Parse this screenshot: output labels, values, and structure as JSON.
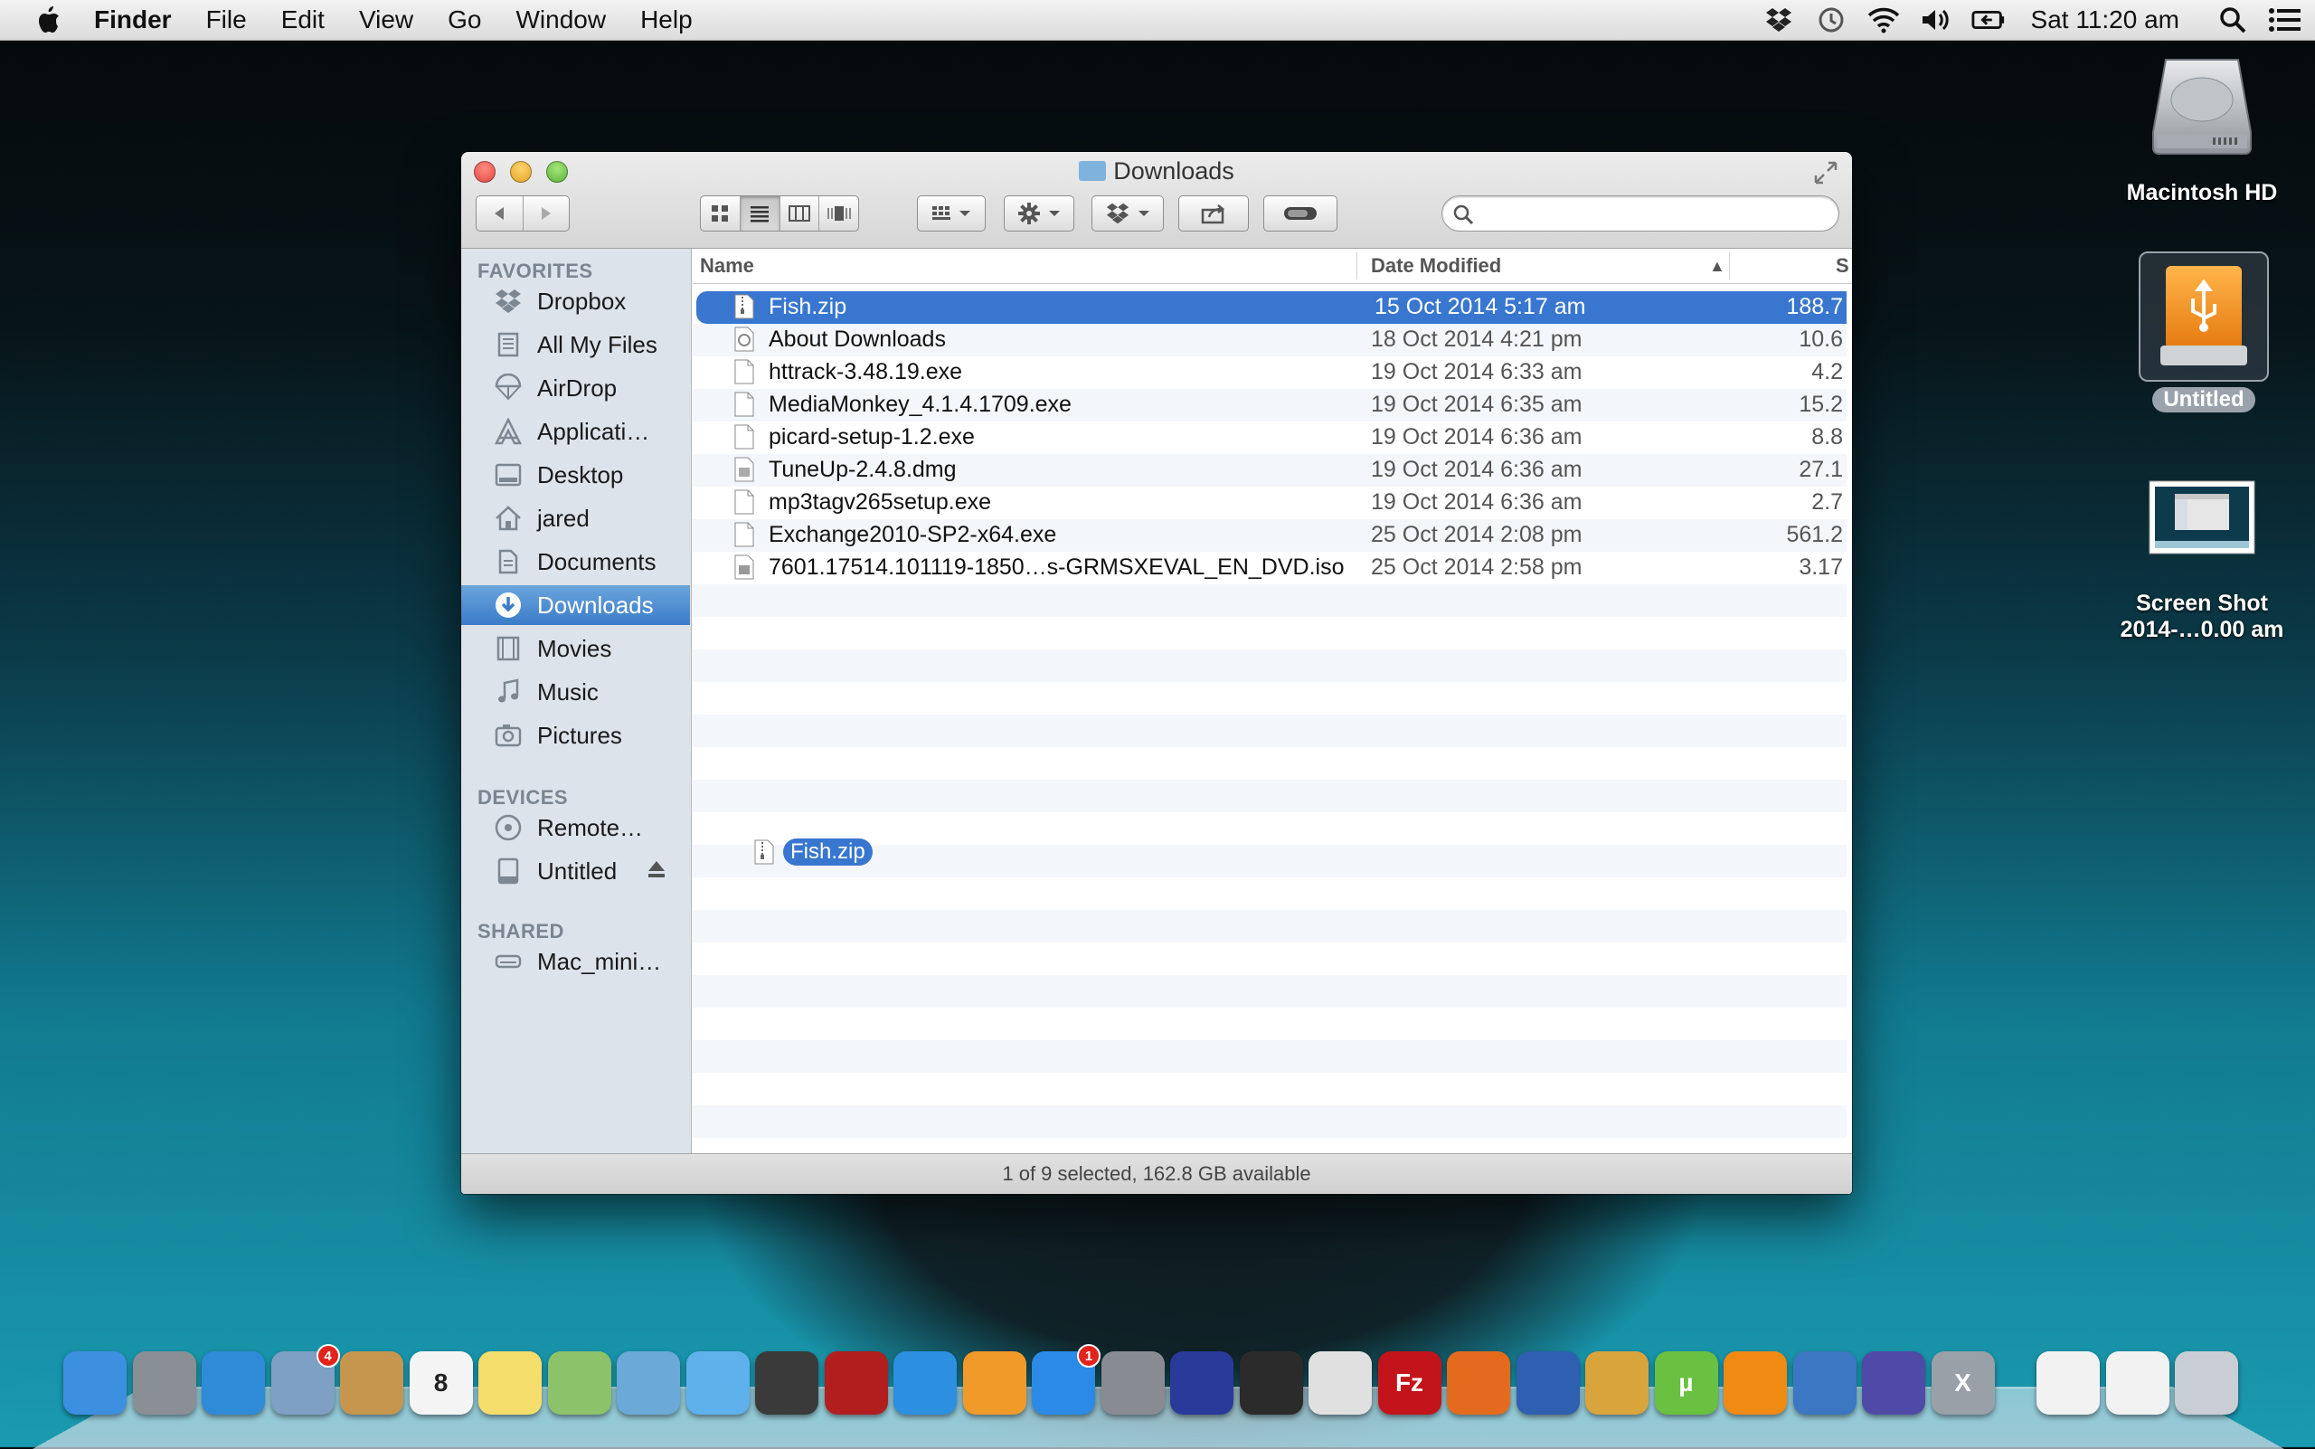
{
  "menubar": {
    "app_name": "Finder",
    "menus": [
      "File",
      "Edit",
      "View",
      "Go",
      "Window",
      "Help"
    ],
    "clock": "Sat 11:20 am",
    "status_icons": [
      "dropbox-icon",
      "time-machine-icon",
      "wifi-icon",
      "volume-icon",
      "battery-icon",
      "spotlight-icon",
      "notification-center-icon"
    ]
  },
  "window": {
    "title": "Downloads",
    "status_text": "1 of 9 selected, 162.8 GB available",
    "toolbar": {
      "view_modes": [
        "icon-view",
        "list-view",
        "column-view",
        "cover-flow-view"
      ],
      "active_view": "list-view",
      "search_placeholder": ""
    }
  },
  "sidebar": {
    "favorites_header": "FAVORITES",
    "favorites": [
      {
        "label": "Dropbox",
        "icon": "dropbox-icon"
      },
      {
        "label": "All My Files",
        "icon": "all-files-icon"
      },
      {
        "label": "AirDrop",
        "icon": "airdrop-icon"
      },
      {
        "label": "Applicati…",
        "icon": "applications-icon"
      },
      {
        "label": "Desktop",
        "icon": "desktop-icon"
      },
      {
        "label": "jared",
        "icon": "home-icon"
      },
      {
        "label": "Documents",
        "icon": "documents-icon"
      },
      {
        "label": "Downloads",
        "icon": "downloads-icon",
        "selected": true
      },
      {
        "label": "Movies",
        "icon": "movies-icon"
      },
      {
        "label": "Music",
        "icon": "music-icon"
      },
      {
        "label": "Pictures",
        "icon": "pictures-icon"
      }
    ],
    "devices_header": "DEVICES",
    "devices": [
      {
        "label": "Remote…",
        "icon": "remote-disc-icon"
      },
      {
        "label": "Untitled",
        "icon": "drive-icon"
      }
    ],
    "shared_header": "SHARED",
    "shared": [
      {
        "label": "Mac_mini…",
        "icon": "network-computer-icon"
      }
    ]
  },
  "list": {
    "columns": {
      "name": "Name",
      "date": "Date Modified",
      "size": "S"
    },
    "sort_indicator": "▲",
    "files": [
      {
        "name": "Fish.zip",
        "date": "15 Oct 2014 5:17 am",
        "size": "188.7",
        "selected": true
      },
      {
        "name": "About Downloads",
        "date": "18 Oct 2014 4:21 pm",
        "size": "10.6"
      },
      {
        "name": "httrack-3.48.19.exe",
        "date": "19 Oct 2014 6:33 am",
        "size": "4.2"
      },
      {
        "name": "MediaMonkey_4.1.4.1709.exe",
        "date": "19 Oct 2014 6:35 am",
        "size": "15.2"
      },
      {
        "name": "picard-setup-1.2.exe",
        "date": "19 Oct 2014 6:36 am",
        "size": "8.8"
      },
      {
        "name": "TuneUp-2.4.8.dmg",
        "date": "19 Oct 2014 6:36 am",
        "size": "27.1"
      },
      {
        "name": "mp3tagv265setup.exe",
        "date": "19 Oct 2014 6:36 am",
        "size": "2.7"
      },
      {
        "name": "Exchange2010-SP2-x64.exe",
        "date": "25 Oct 2014 2:08 pm",
        "size": "561.2"
      },
      {
        "name": "7601.17514.101119-1850…s-GRMSXEVAL_EN_DVD.iso",
        "date": "25 Oct 2014 2:58 pm",
        "size": "3.17"
      }
    ],
    "drag_ghost": "Fish.zip"
  },
  "desktop": {
    "icons": [
      {
        "label": "Macintosh HD",
        "icon": "hard-drive-icon"
      },
      {
        "label": "Untitled",
        "icon": "usb-drive-icon",
        "selected": true
      },
      {
        "label": "Screen Shot\n2014-…0.00 am",
        "line1": "Screen Shot",
        "line2": "2014-…0.00 am",
        "icon": "screenshot-file-icon"
      }
    ]
  },
  "dock": {
    "apps": [
      {
        "name": "finder-icon",
        "color": "#3d8fe0"
      },
      {
        "name": "launchpad-icon",
        "color": "#8a8f96"
      },
      {
        "name": "safari-icon",
        "color": "#2f8ad8"
      },
      {
        "name": "mail-icon",
        "color": "#7da0c4",
        "badge": "4"
      },
      {
        "name": "contacts-icon",
        "color": "#c6964e"
      },
      {
        "name": "calendar-icon",
        "color": "#f4f4f4",
        "text": "8"
      },
      {
        "name": "notes-icon",
        "color": "#f4dd6a"
      },
      {
        "name": "maps-icon",
        "color": "#8cc26a"
      },
      {
        "name": "iphoto-icon",
        "color": "#6aa9d8"
      },
      {
        "name": "messages-icon",
        "color": "#5fb1ec"
      },
      {
        "name": "facetime-icon",
        "color": "#3a3a3a"
      },
      {
        "name": "photo-booth-icon",
        "color": "#b21e1e"
      },
      {
        "name": "itunes-icon",
        "color": "#2c8fe0"
      },
      {
        "name": "ibooks-icon",
        "color": "#f09a2a"
      },
      {
        "name": "app-store-icon",
        "color": "#2a8ae6",
        "badge": "1"
      },
      {
        "name": "system-preferences-icon",
        "color": "#888c92"
      },
      {
        "name": "audacity-icon",
        "color": "#2a3a9a"
      },
      {
        "name": "dashboard-icon",
        "color": "#2b2b2b"
      },
      {
        "name": "chrome-icon",
        "color": "#e0e0e0"
      },
      {
        "name": "filezilla-icon",
        "color": "#c3141b",
        "text": "Fz"
      },
      {
        "name": "firefox-icon",
        "color": "#e46b1e"
      },
      {
        "name": "fs-icon",
        "color": "#2e5fb0"
      },
      {
        "name": "cocktail-icon",
        "color": "#d9a43c"
      },
      {
        "name": "utorrent-icon",
        "color": "#6ac040",
        "text": "µ"
      },
      {
        "name": "vlc-icon",
        "color": "#f08a12"
      },
      {
        "name": "remote-desktop-icon",
        "color": "#3b77c2"
      },
      {
        "name": "monitor-icon",
        "color": "#4f4aa8"
      },
      {
        "name": "x11-icon",
        "color": "#9aa0a8",
        "text": "X"
      },
      {
        "name": "rtf-document-icon",
        "color": "#f2f2f2"
      },
      {
        "name": "document-icon",
        "color": "#f2f2f2"
      },
      {
        "name": "trash-icon",
        "color": "#c9ced4"
      }
    ]
  }
}
